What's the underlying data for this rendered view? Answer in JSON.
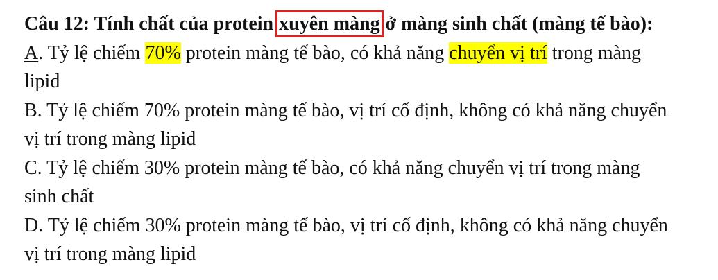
{
  "question": {
    "title_prefix": "Câu 12: Tính chất của protein ",
    "title_boxed": "xuyên màng",
    "title_suffix": " ở màng sinh chất (màng tế bào):"
  },
  "options": {
    "a": {
      "letter": "A",
      "p1": ". Tỷ lệ chiếm ",
      "hl1": "70%",
      "p2": " protein màng tế bào, có khả năng ",
      "hl2": "chuyển vị trí",
      "p3": " trong màng",
      "line2": "lipid"
    },
    "b": {
      "line1": "B. Tỷ lệ chiếm 70% protein màng tế bào, vị trí cố định, không có khả năng chuyển",
      "line2": "vị trí trong màng lipid"
    },
    "c": {
      "line1": "C. Tỷ lệ chiếm 30% protein màng tế bào, có khả năng chuyển vị trí trong màng",
      "line2": "sinh chất"
    },
    "d": {
      "line1": "D. Tỷ lệ chiếm 30% protein màng tế bào, vị trí cố định, không có khả năng chuyển",
      "line2": "vị trí trong màng lipid"
    }
  },
  "colors": {
    "highlight": "#ffff00",
    "box_outline": "#e02020",
    "text": "#111111"
  }
}
